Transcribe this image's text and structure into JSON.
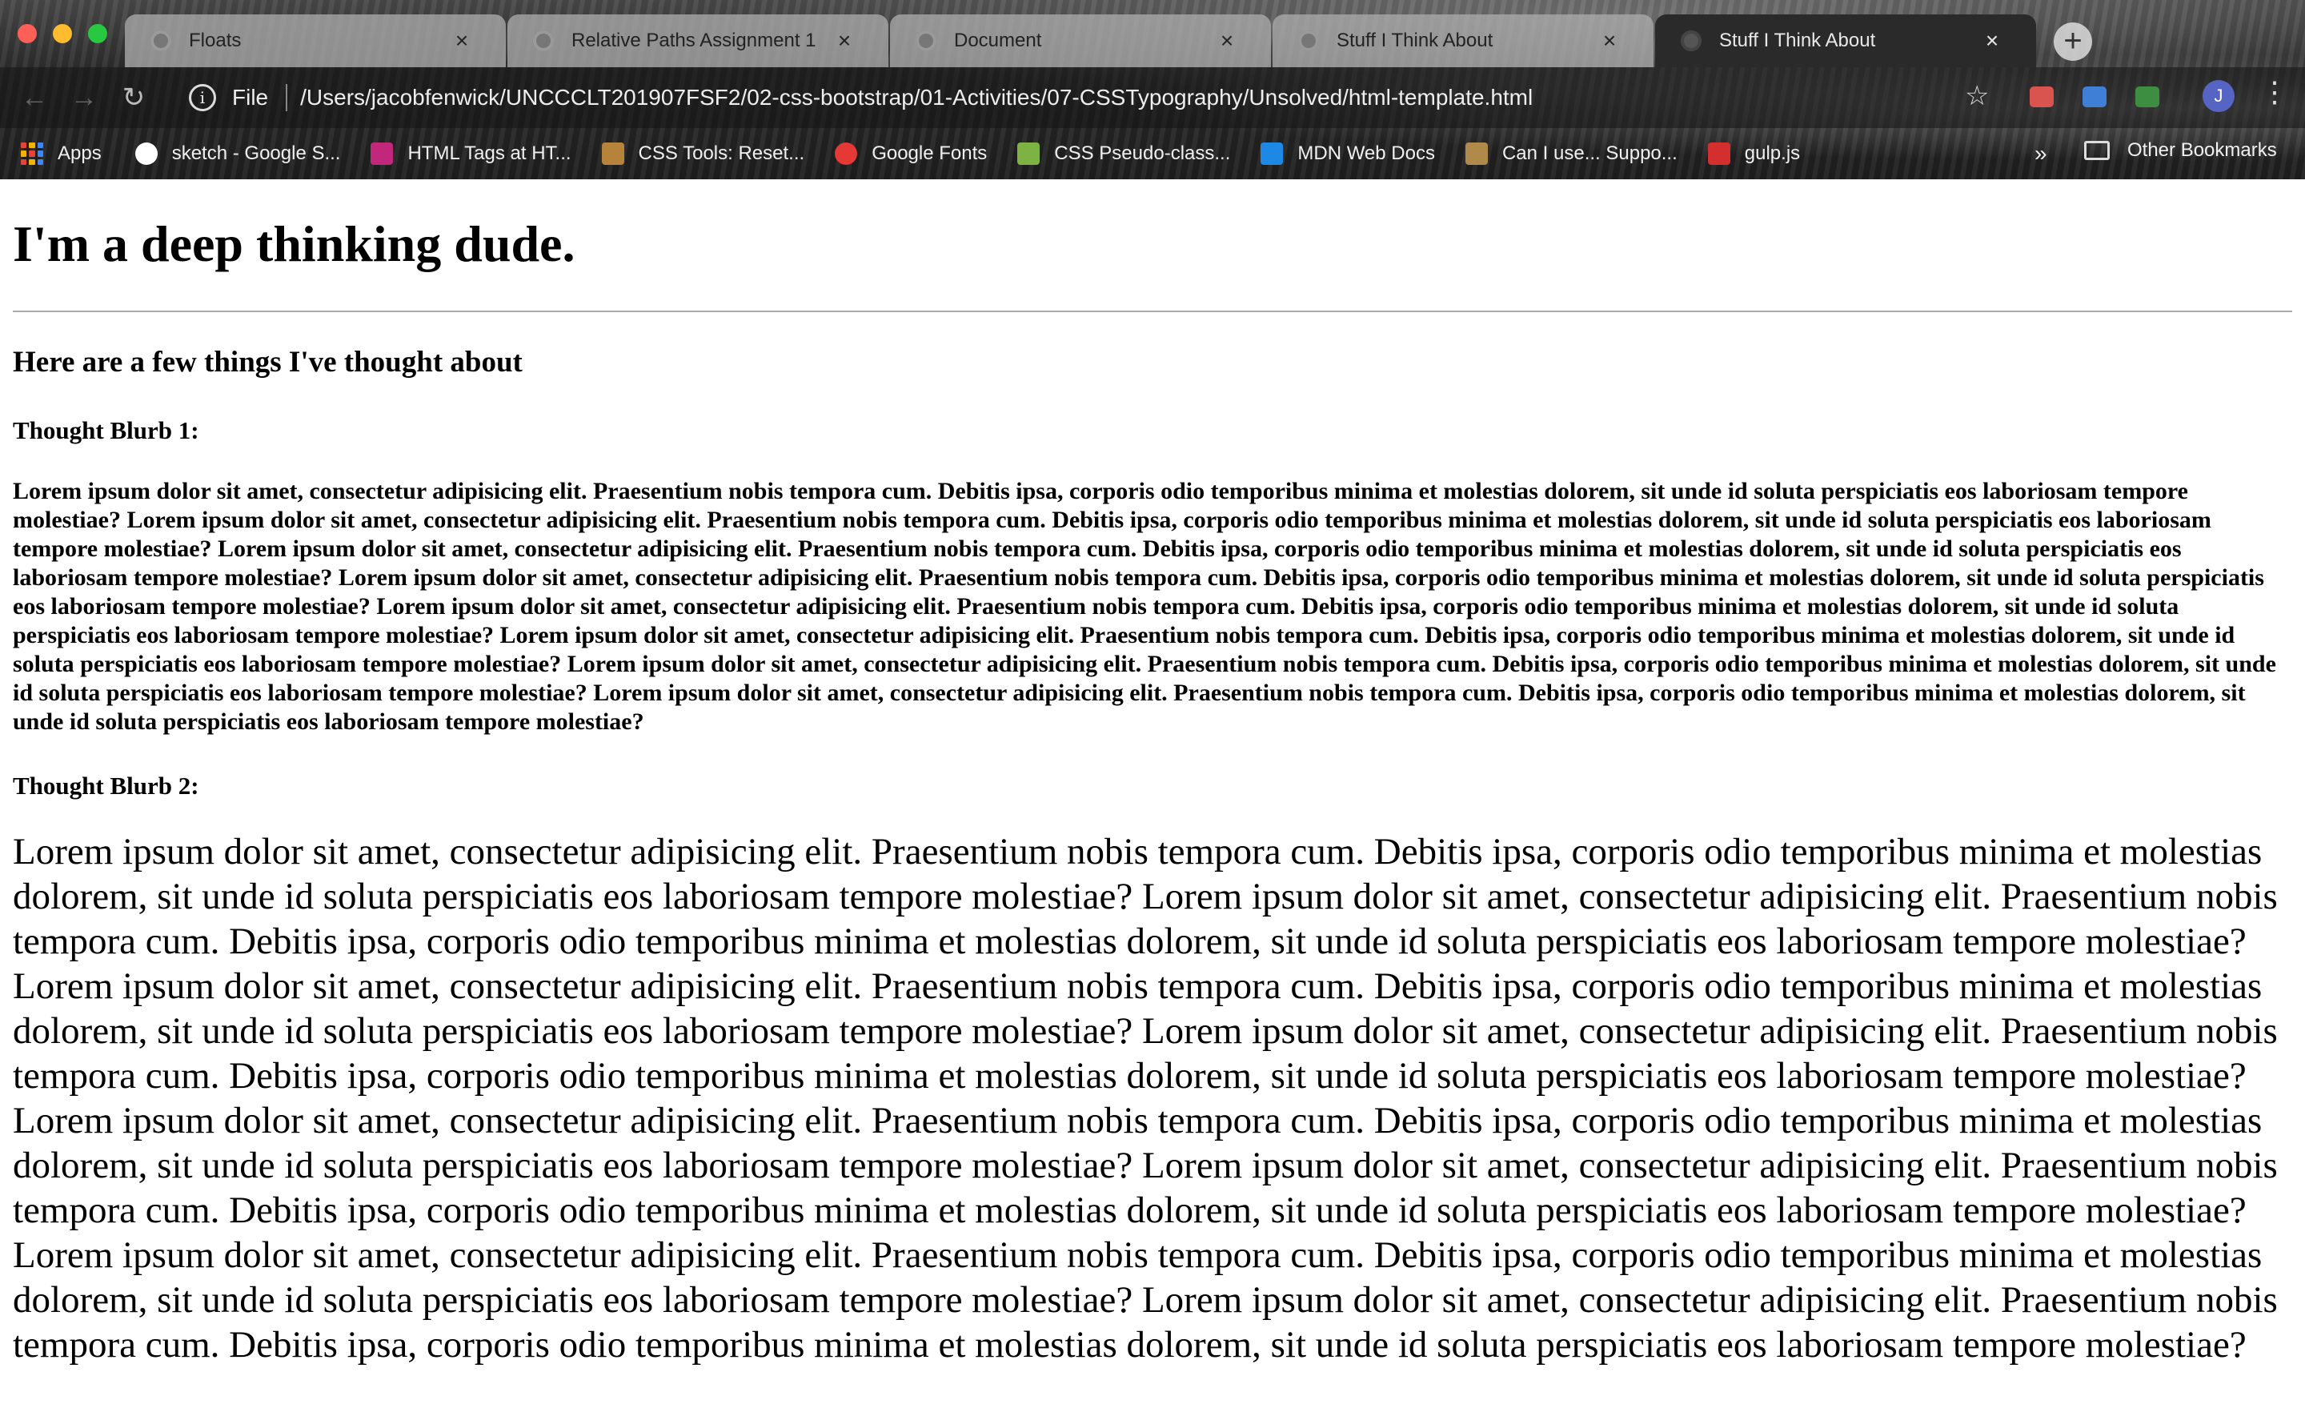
{
  "browser": {
    "tabs": [
      {
        "title": "Floats",
        "active": false
      },
      {
        "title": "Relative Paths Assignment 1",
        "active": false
      },
      {
        "title": "Document",
        "active": false
      },
      {
        "title": "Stuff I Think About",
        "active": false
      },
      {
        "title": "Stuff I Think About",
        "active": true
      }
    ],
    "new_tab": "+",
    "close_glyph": "×",
    "address": {
      "scheme_label": "File",
      "url": "/Users/jacobfenwick/UNCCCLT201907FSF2/02-css-bootstrap/01-Activities/07-CSSTypography/Unsolved/html-template.html"
    },
    "avatar_letter": "J",
    "bookmarks": [
      {
        "label": "Apps",
        "icon": "apps-grid-icon"
      },
      {
        "label": "sketch - Google S...",
        "icon": "google-icon",
        "color": "#ffffff"
      },
      {
        "label": "HTML Tags at HT...",
        "icon": "html-h-icon",
        "color": "#c1277a"
      },
      {
        "label": "CSS Tools: Reset...",
        "icon": "meyer-icon",
        "color": "#b5833a"
      },
      {
        "label": "Google Fonts",
        "icon": "google-fonts-icon",
        "color": "#e53935"
      },
      {
        "label": "CSS Pseudo-class...",
        "icon": "w3-icon",
        "color": "#7cb342"
      },
      {
        "label": "MDN Web Docs",
        "icon": "mdn-icon",
        "color": "#1e88e5"
      },
      {
        "label": "Can I use... Suppo...",
        "icon": "caniuse-icon",
        "color": "#b08a4a"
      },
      {
        "label": "gulp.js",
        "icon": "gulp-icon",
        "color": "#d32f2f"
      }
    ],
    "overflow": "»",
    "other_bookmarks": "Other Bookmarks"
  },
  "page": {
    "heading": "I'm a deep thinking dude.",
    "subheading": "Here are a few things I've thought about",
    "blurb1_title": "Thought Blurb 1:",
    "blurb1_text": "Lorem ipsum dolor sit amet, consectetur adipisicing elit. Praesentium nobis tempora cum. Debitis ipsa, corporis odio temporibus minima et molestias dolorem, sit unde id soluta perspiciatis eos laboriosam tempore molestiae? Lorem ipsum dolor sit amet, consectetur adipisicing elit. Praesentium nobis tempora cum. Debitis ipsa, corporis odio temporibus minima et molestias dolorem, sit unde id soluta perspiciatis eos laboriosam tempore molestiae? Lorem ipsum dolor sit amet, consectetur adipisicing elit. Praesentium nobis tempora cum. Debitis ipsa, corporis odio temporibus minima et molestias dolorem, sit unde id soluta perspiciatis eos laboriosam tempore molestiae? Lorem ipsum dolor sit amet, consectetur adipisicing elit. Praesentium nobis tempora cum. Debitis ipsa, corporis odio temporibus minima et molestias dolorem, sit unde id soluta perspiciatis eos laboriosam tempore molestiae? Lorem ipsum dolor sit amet, consectetur adipisicing elit. Praesentium nobis tempora cum. Debitis ipsa, corporis odio temporibus minima et molestias dolorem, sit unde id soluta perspiciatis eos laboriosam tempore molestiae? Lorem ipsum dolor sit amet, consectetur adipisicing elit. Praesentium nobis tempora cum. Debitis ipsa, corporis odio temporibus minima et molestias dolorem, sit unde id soluta perspiciatis eos laboriosam tempore molestiae? Lorem ipsum dolor sit amet, consectetur adipisicing elit. Praesentium nobis tempora cum. Debitis ipsa, corporis odio temporibus minima et molestias dolorem, sit unde id soluta perspiciatis eos laboriosam tempore molestiae? Lorem ipsum dolor sit amet, consectetur adipisicing elit. Praesentium nobis tempora cum. Debitis ipsa, corporis odio temporibus minima et molestias dolorem, sit unde id soluta perspiciatis eos laboriosam tempore molestiae?",
    "blurb2_title": "Thought Blurb 2:",
    "blurb2_text": "Lorem ipsum dolor sit amet, consectetur adipisicing elit. Praesentium nobis tempora cum. Debitis ipsa, corporis odio temporibus minima et molestias dolorem, sit unde id soluta perspiciatis eos laboriosam tempore molestiae? Lorem ipsum dolor sit amet, consectetur adipisicing elit. Praesentium nobis tempora cum. Debitis ipsa, corporis odio temporibus minima et molestias dolorem, sit unde id soluta perspiciatis eos laboriosam tempore molestiae? Lorem ipsum dolor sit amet, consectetur adipisicing elit. Praesentium nobis tempora cum. Debitis ipsa, corporis odio temporibus minima et molestias dolorem, sit unde id soluta perspiciatis eos laboriosam tempore molestiae? Lorem ipsum dolor sit amet, consectetur adipisicing elit. Praesentium nobis tempora cum. Debitis ipsa, corporis odio temporibus minima et molestias dolorem, sit unde id soluta perspiciatis eos laboriosam tempore molestiae? Lorem ipsum dolor sit amet, consectetur adipisicing elit. Praesentium nobis tempora cum. Debitis ipsa, corporis odio temporibus minima et molestias dolorem, sit unde id soluta perspiciatis eos laboriosam tempore molestiae? Lorem ipsum dolor sit amet, consectetur adipisicing elit. Praesentium nobis tempora cum. Debitis ipsa, corporis odio temporibus minima et molestias dolorem, sit unde id soluta perspiciatis eos laboriosam tempore molestiae? Lorem ipsum dolor sit amet, consectetur adipisicing elit. Praesentium nobis tempora cum. Debitis ipsa, corporis odio temporibus minima et molestias dolorem, sit unde id soluta perspiciatis eos laboriosam tempore molestiae? Lorem ipsum dolor sit amet, consectetur adipisicing elit. Praesentium nobis tempora cum. Debitis ipsa, corporis odio temporibus minima et molestias dolorem, sit unde id soluta perspiciatis eos laboriosam tempore molestiae?"
  }
}
